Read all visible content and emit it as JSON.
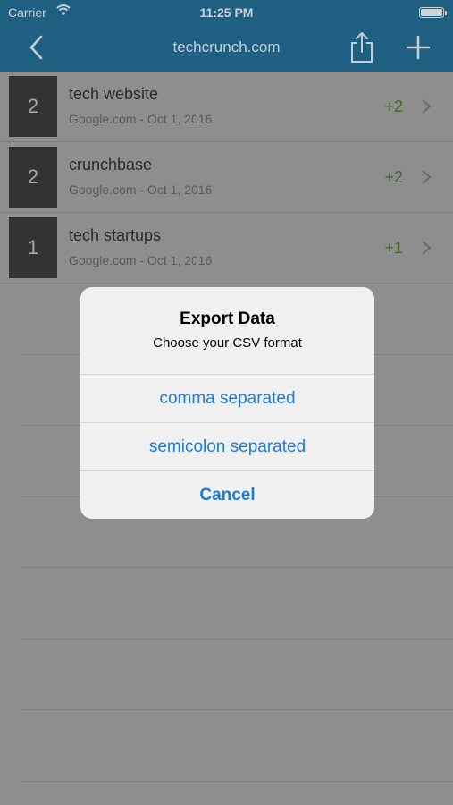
{
  "status_bar": {
    "carrier": "Carrier",
    "time": "11:25 PM"
  },
  "nav": {
    "title": "techcrunch.com"
  },
  "rows": [
    {
      "count": "2",
      "keyword": "tech website",
      "meta": "Google.com - Oct 1, 2016",
      "delta": "+2"
    },
    {
      "count": "2",
      "keyword": "crunchbase",
      "meta": "Google.com - Oct 1, 2016",
      "delta": "+2"
    },
    {
      "count": "1",
      "keyword": "tech startups",
      "meta": "Google.com - Oct 1, 2016",
      "delta": "+1"
    }
  ],
  "dialog": {
    "title": "Export Data",
    "message": "Choose your CSV format",
    "options": [
      "comma separated",
      "semicolon separated"
    ],
    "cancel": "Cancel"
  },
  "colors": {
    "nav_bg": "#1f5f82",
    "accent": "#1a7ddc",
    "delta_green": "#3d6b2c"
  }
}
